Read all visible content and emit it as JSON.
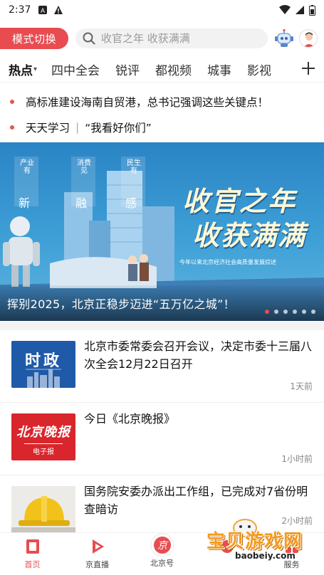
{
  "status_bar": {
    "time": "2:37",
    "icons": [
      "sim-a-icon",
      "warning-icon",
      "wifi-icon",
      "signal-icon",
      "battery-icon"
    ]
  },
  "header": {
    "mode_button_label": "模式切换",
    "search_placeholder": "收官之年 收获满满",
    "robot_icon": "robot-assistant-icon",
    "avatar_icon": "user-avatar-icon"
  },
  "tabs": [
    {
      "label": "热点",
      "active": true
    },
    {
      "label": "四中全会",
      "active": false
    },
    {
      "label": "锐评",
      "active": false
    },
    {
      "label": "都视频",
      "active": false
    },
    {
      "label": "城事",
      "active": false
    },
    {
      "label": "影视",
      "active": false
    }
  ],
  "headlines": [
    {
      "text": "高标准建设海南自贸港，总书记强调这些关键点！"
    },
    {
      "part1": "天天学习",
      "sep": "|",
      "part2": "“我看好你们”"
    }
  ],
  "banner": {
    "tags": [
      {
        "top": "产业有",
        "main": "新"
      },
      {
        "top": "消费见",
        "main": "融"
      },
      {
        "top": "民生有",
        "main": "感"
      }
    ],
    "slogan_line1": "收官之年",
    "slogan_line2": "收获满满",
    "subtitle": "今年以来北京经济社会高质量发展综述",
    "caption": "挥别2025，北京正稳步迈进“五万亿之城”！",
    "slide_count": 6,
    "active_slide": 1
  },
  "news": [
    {
      "thumb_label": "时政",
      "title": "北京市委常委会召开会议，决定市委十三届八次全会12月22日召开",
      "time": "1天前"
    },
    {
      "thumb_label": "北京晚报",
      "thumb_sub": "电子报",
      "title": "今日《北京晚报》",
      "time": "1小时前"
    },
    {
      "title": "国务院安委办派出工作组，已完成对7省份明查暗访",
      "time": "2小时前"
    }
  ],
  "bottom_nav": [
    {
      "label": "首页",
      "icon": "home-icon",
      "active": true
    },
    {
      "label": "京直播",
      "icon": "live-play-icon",
      "active": false
    },
    {
      "label": "北京号",
      "icon": "beijing-account-icon",
      "active": false
    },
    {
      "label": "",
      "icon": "partially-hidden-icon",
      "active": false
    },
    {
      "label": "服务",
      "icon": "service-icon",
      "active": false
    }
  ],
  "watermark": {
    "text": "宝贝游戏网",
    "url_text": "baobeiy.com"
  },
  "colors": {
    "brand_red": "#e84c50",
    "banner_blue": "#2a84c4",
    "thumb_blue": "#1f5aa8",
    "thumb_red": "#d9262c"
  }
}
